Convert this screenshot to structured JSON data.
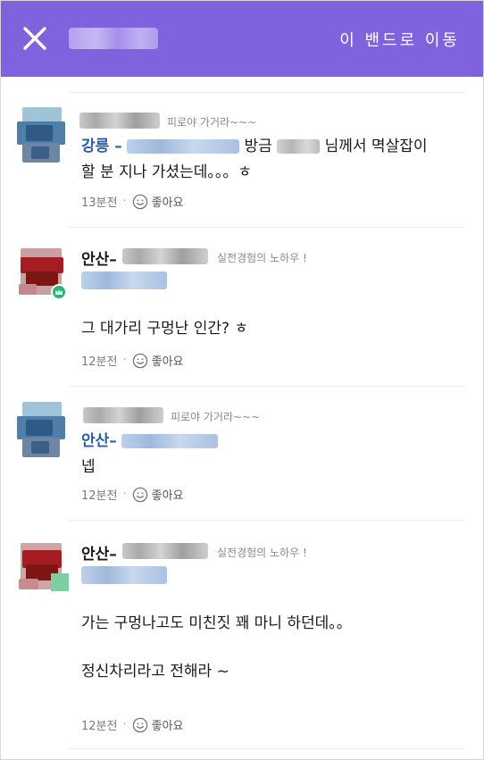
{
  "header": {
    "close_icon": "close-icon",
    "goto_band_label": "이 밴드로 이동"
  },
  "comments": [
    {
      "bio": "피로야 가거라~~~",
      "mention": "강릉 –",
      "text_a": "방금",
      "text_b": "님께서 멱살잡이",
      "text_line2": "할 분 지나 가셨는데。。。ㅎ",
      "time": "13분전",
      "like_label": "좋아요"
    },
    {
      "name_prefix": "안산–",
      "bio": "실전경험의 노하우 !",
      "text": "그 대가리 구멍난 인간? ㅎ",
      "time": "12분전",
      "like_label": "좋아요"
    },
    {
      "bio": "피로야 가거라~~~",
      "mention": "안산–",
      "text": "넵",
      "time": "12분전",
      "like_label": "좋아요"
    },
    {
      "name_prefix": "안산–",
      "bio": "실전경험의 노하우 !",
      "text_line1": "가는 구멍나고도 미친짓 꽤 마니 하던데。。",
      "text_line2": "정신차리라고 전해라 ~",
      "time": "12분전",
      "like_label": "좋아요"
    }
  ],
  "colors": {
    "header_bg": "#7e62de",
    "mention": "#2a5ca8",
    "manager_badge": "#1fb978"
  }
}
